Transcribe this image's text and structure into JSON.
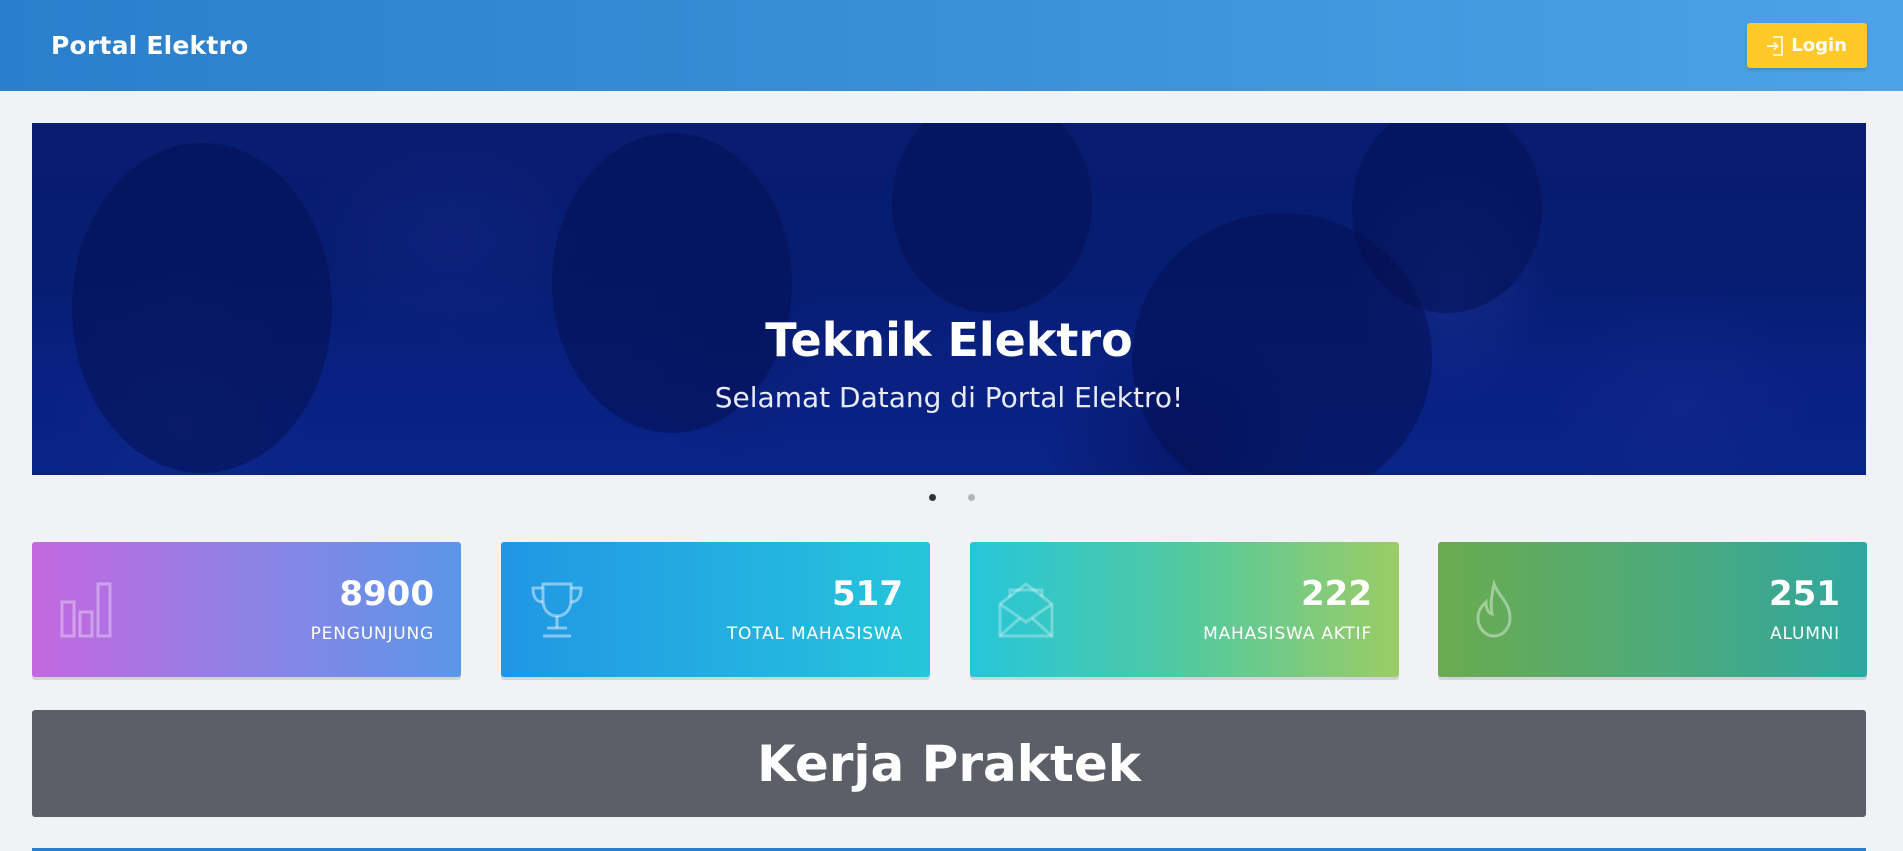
{
  "navbar": {
    "brand": "Portal Elektro",
    "login_label": "Login"
  },
  "carousel": {
    "title": "Teknik Elektro",
    "subtitle": "Selamat Datang di Portal Elektro!",
    "slide_count": 2,
    "active_slide": 1
  },
  "stats": [
    {
      "value": "8900",
      "label": "PENGUNJUNG",
      "icon": "bar-chart-icon"
    },
    {
      "value": "517",
      "label": "TOTAL MAHASISWA",
      "icon": "trophy-icon"
    },
    {
      "value": "222",
      "label": "MAHASISWA AKTIF",
      "icon": "envelope-open-icon"
    },
    {
      "value": "251",
      "label": "ALUMNI",
      "icon": "fire-icon"
    }
  ],
  "section": {
    "title": "Kerja Praktek"
  },
  "colors": {
    "navbar": "#2a7fcc",
    "login_button": "#ffca28",
    "section_header": "#5c5f67"
  }
}
